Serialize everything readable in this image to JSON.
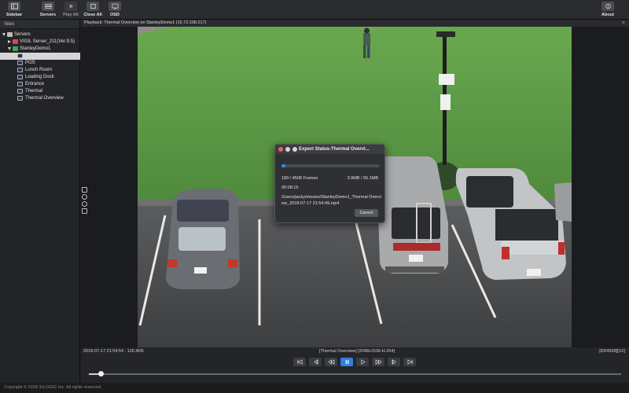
{
  "toolbar": {
    "sidebar": "Sidebar",
    "servers": "Servers",
    "play_all": "Play All",
    "close_all": "Close All",
    "osd": "OSD",
    "about": "About"
  },
  "sidebar": {
    "header": "Sites",
    "tree": {
      "servers": "Servers",
      "server": "VIGIL Server_211(Ver.9.5)",
      "site": "StanleyDemo1",
      "selected_camera": "",
      "cameras": [
        "POS",
        "Lunch Room",
        "Loading Dock",
        "Entrance",
        "Thermal",
        "Thermal Overview"
      ]
    }
  },
  "playback": {
    "title": "Playback: Thermal Overview on StanleyDemo1 (15.72.108.217)",
    "close_glyph": "×"
  },
  "dialog": {
    "title": "Export Status-Thermal Overvi...",
    "frames": "189 / 4508 Frames",
    "size": "3.9MB / 95.1MB",
    "elapsed": "00:08:15",
    "path": "/Users/jacky/movies/StanleyDemo1_Thermal Overview_2018-07-17 21:54:49.mp4",
    "progress": 0.042,
    "cancel": "Cancel"
  },
  "controls": {
    "left_status": "2018-07-17 21:54:54 : 120.4KB",
    "center_status": "[Thermal Overview] [2048x1536-H.264]",
    "right_status": "[83/4508][1X]",
    "scrub_position": 0.022
  },
  "status_bar": {
    "copyright": "Copyright © 2018 3xLOGIC Inc. All rights reserved."
  },
  "colors": {
    "accent": "#2f8ff0",
    "grass": "#5f9d47",
    "asphalt": "#4a4c4e"
  }
}
